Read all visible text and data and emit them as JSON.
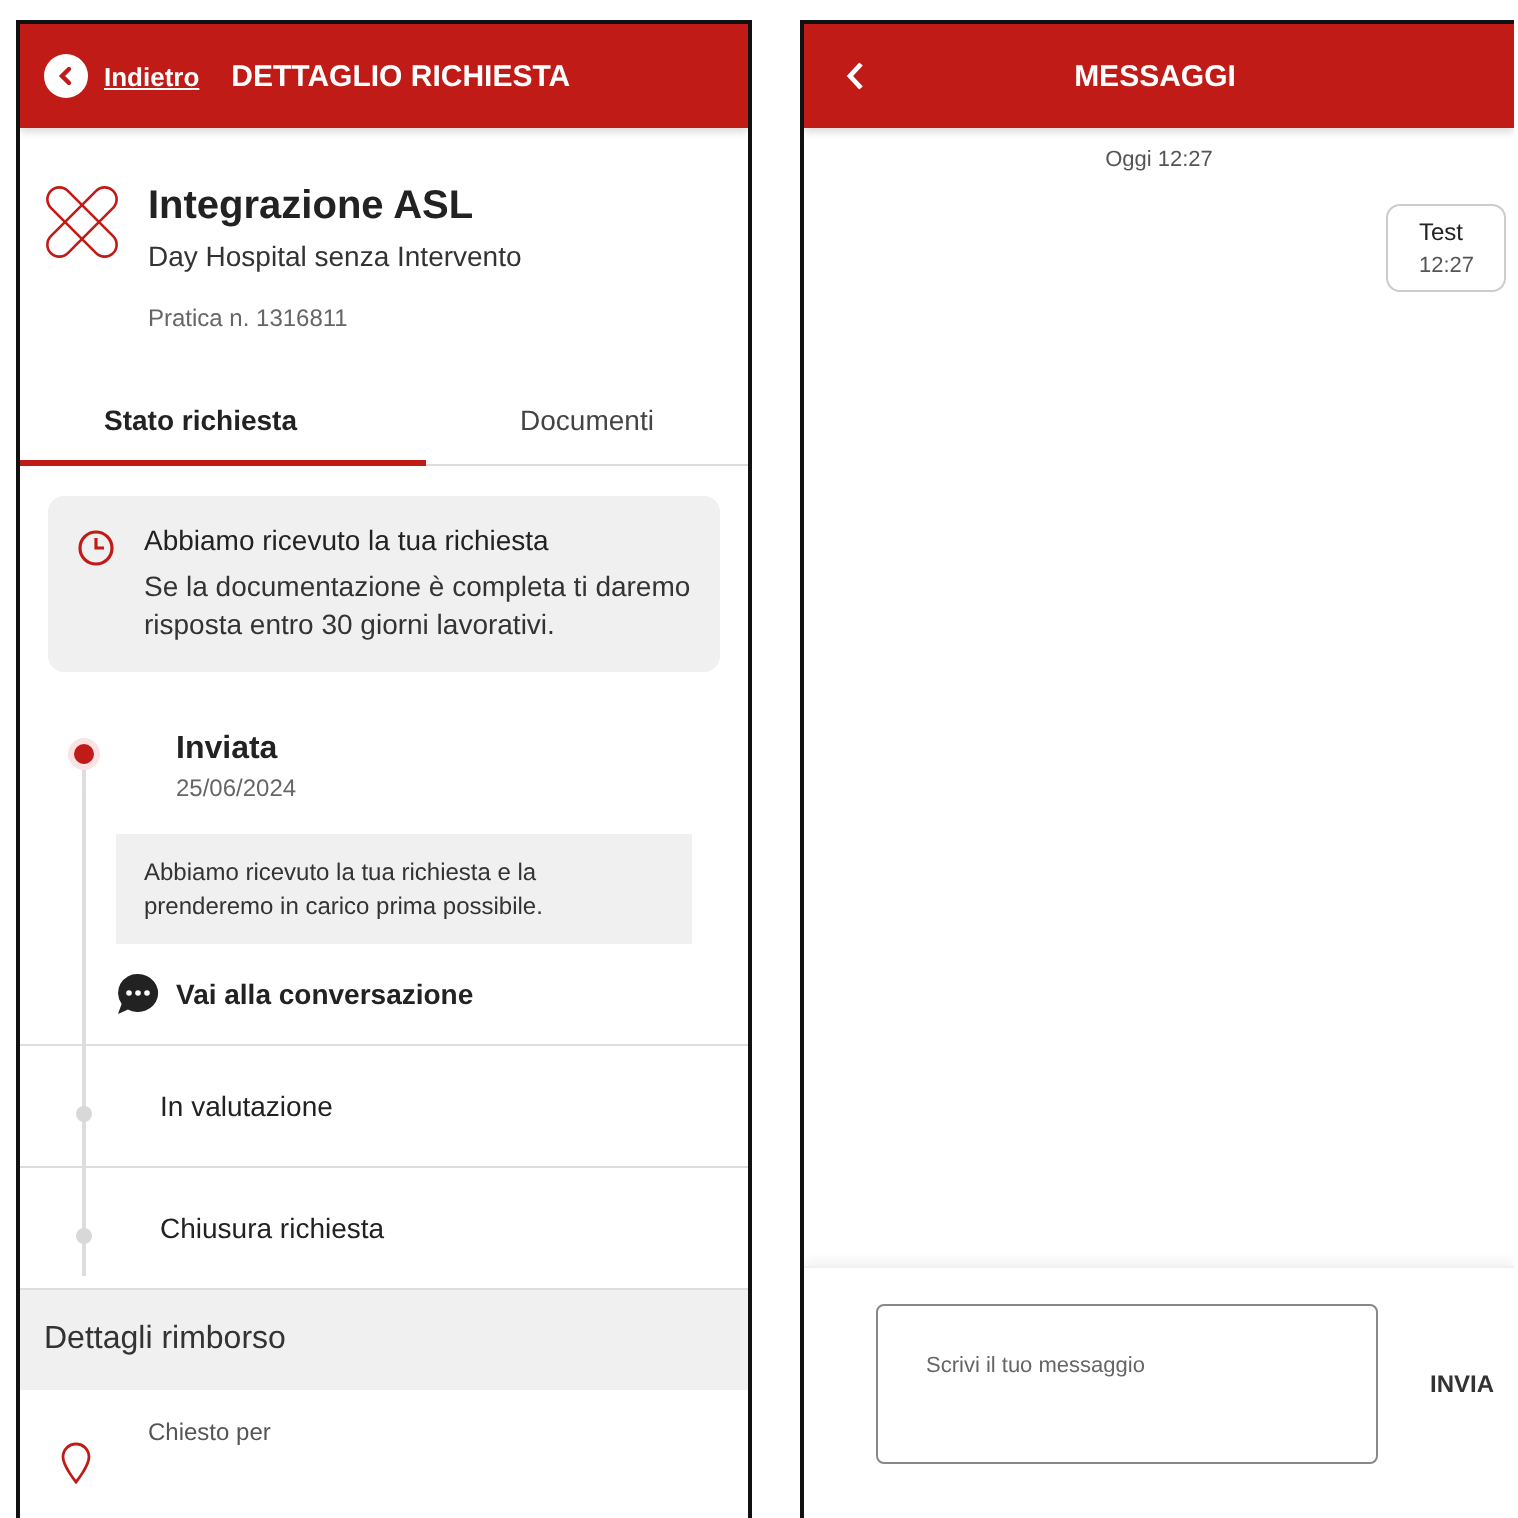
{
  "detail_screen": {
    "header": {
      "back_label": "Indietro",
      "title": "DETTAGLIO RICHIESTA"
    },
    "product": {
      "title": "Integrazione ASL",
      "subtitle": "Day Hospital senza Intervento",
      "case_number": "Pratica n. 1316811"
    },
    "tabs": [
      {
        "label": "Stato richiesta",
        "selected": true
      },
      {
        "label": "Documenti",
        "selected": false
      }
    ],
    "notice": {
      "title": "Abbiamo ricevuto la tua richiesta",
      "text": "Se la documentazione è completa ti daremo risposta entro 30 giorni lavorativi."
    },
    "timeline": [
      {
        "title": "Inviata",
        "active": true,
        "date": "25/06/2024",
        "note": "Abbiamo ricevuto la tua richiesta e la prenderemo in carico prima possibile.",
        "link": "Vai alla conversazione"
      },
      {
        "title": "In valutazione",
        "active": false
      },
      {
        "title": "Chiusura richiesta",
        "active": false
      }
    ],
    "section_title": "Dettagli rimborso",
    "detail_label": "Chiesto per"
  },
  "messages_screen": {
    "header": {
      "title": "MESSAGGI"
    },
    "timestamp": "Oggi 12:27",
    "messages": [
      {
        "text": "Test",
        "time": "12:27"
      }
    ],
    "composer": {
      "placeholder": "Scrivi il tuo messaggio",
      "send_label": "INVIA"
    }
  }
}
